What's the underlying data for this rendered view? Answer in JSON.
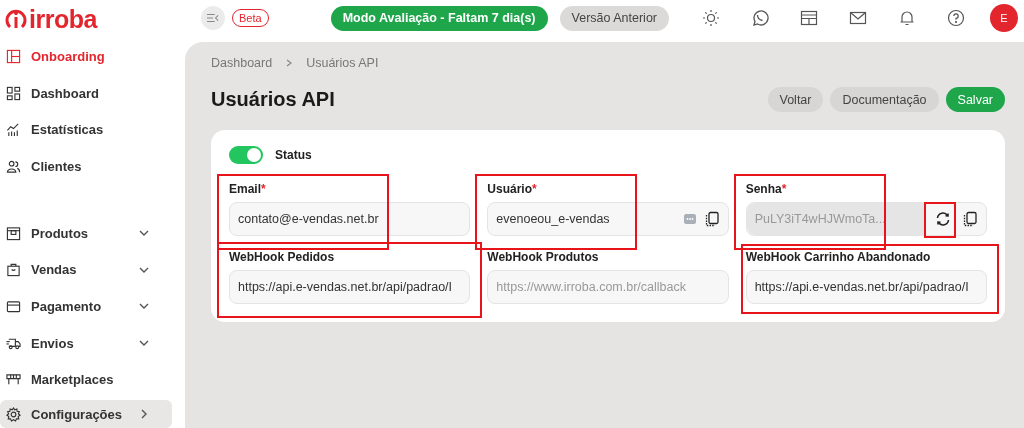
{
  "logo": "irroba",
  "header": {
    "beta": "Beta",
    "trial": "Modo Avaliação - Faltam 7 dia(s)",
    "previous": "Versão Anterior",
    "avatar": "E"
  },
  "sidebar": {
    "items": [
      {
        "label": "Onboarding",
        "kind": "highlight",
        "selected": false
      },
      {
        "label": "Dashboard",
        "kind": "plain",
        "selected": false
      },
      {
        "label": "Estatísticas",
        "kind": "plain",
        "selected": false
      },
      {
        "label": "Clientes",
        "kind": "plain",
        "selected": false
      },
      {
        "kind": "spacer"
      },
      {
        "label": "Produtos",
        "kind": "group",
        "selected": false
      },
      {
        "label": "Vendas",
        "kind": "group",
        "selected": false
      },
      {
        "label": "Pagamento",
        "kind": "group",
        "selected": false
      },
      {
        "label": "Envios",
        "kind": "group",
        "selected": false
      },
      {
        "label": "Marketplaces",
        "kind": "plain",
        "selected": false
      },
      {
        "label": "Configurações",
        "kind": "nav",
        "selected": true
      }
    ]
  },
  "breadcrumb": [
    "Dashboard",
    "Usuários API"
  ],
  "title": "Usuários API",
  "actions": [
    {
      "label": "Voltar",
      "kind": "secondary"
    },
    {
      "label": "Documentação",
      "kind": "secondary"
    },
    {
      "label": "Salvar",
      "kind": "primary"
    }
  ],
  "status": {
    "label": "Status",
    "on": true
  },
  "fields": [
    {
      "label": "Email",
      "required_mark": "*",
      "value": "contato@e-vendas.net.br",
      "kind": "text",
      "highlighted": true
    },
    {
      "label": "Usuário",
      "required_mark": "*",
      "value": "evenoeou_e-vendas",
      "kind": "user",
      "highlighted": true
    },
    {
      "label": "Senha",
      "required_mark": "*",
      "value": "PuLY3iT4wHJWmoTa...",
      "kind": "secret",
      "highlighted": true,
      "refresh_highlighted": true
    },
    {
      "label": "WebHook Pedidos",
      "value": "https://api.e-vendas.net.br/api/padrao/I",
      "kind": "text",
      "highlighted": true
    },
    {
      "label": "WebHook Produtos",
      "placeholder": "https://www.irroba.com.br/callback",
      "kind": "text"
    },
    {
      "label": "WebHook Carrinho Abandonado",
      "value": "https://api.e-vendas.net.br/api/padrao/I",
      "kind": "text",
      "highlighted": true
    }
  ]
}
